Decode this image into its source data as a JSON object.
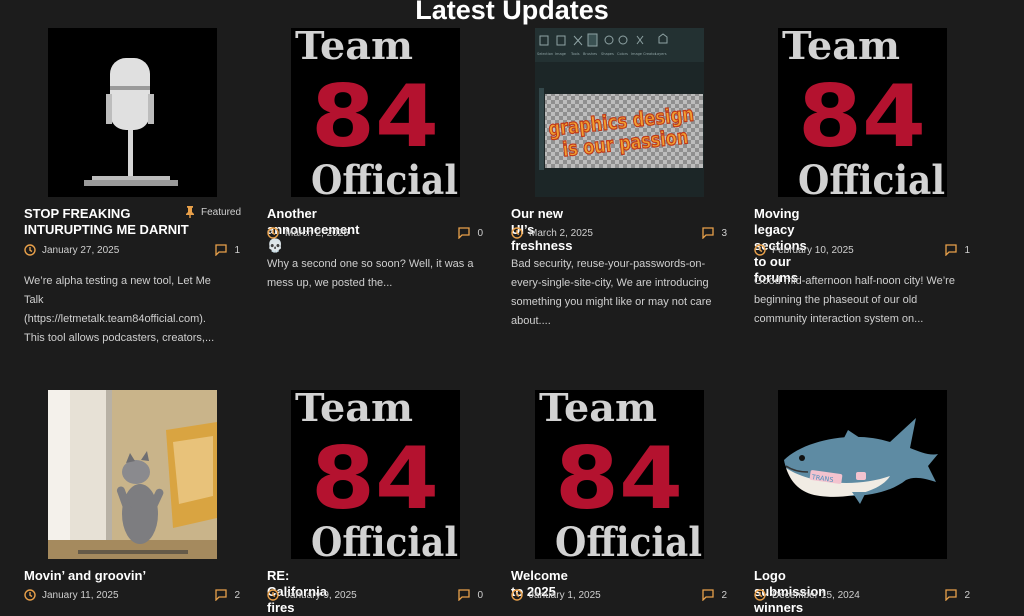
{
  "section_title": "Latest Updates",
  "accent_color": "#e8a04a",
  "brand": {
    "team84_line1": "Team",
    "team84_line2": "84",
    "team84_line3": "Official",
    "team84_red": "#b4122f",
    "team84_grey": "#d2d2d2"
  },
  "posts": [
    {
      "title_line1": "STOP FREAKING",
      "title_line2": "INTURUPTING ME DARNIT",
      "featured_label": "Featured",
      "date": "January 27, 2025",
      "comments": "1",
      "excerpt_lines": [
        "We’re alpha testing a new tool, Let Me",
        "Talk",
        "(https://letmetalk.team84official.com).",
        "This tool allows podcasters, creators,..."
      ],
      "image": "microphone pixel art"
    },
    {
      "title_line1": "Another announcement 💀",
      "date": "March 2, 2025",
      "comments": "0",
      "excerpt_lines": [
        "Why a second one so soon? Well, it was a",
        "mess up, we posted the..."
      ],
      "image": "team84-logo"
    },
    {
      "title_line1": "Our new UI’s freshness",
      "date": "March 2, 2025",
      "comments": "3",
      "excerpt_lines": [
        "Bad security, reuse-your-passwords-on-",
        "every-single-site-city, We are introducing",
        "something you might like or may not care",
        "about...."
      ],
      "image": "graphics editor screenshot",
      "image_text_line1": "graphics design",
      "image_text_line2": "is our passion",
      "toolbar_labels": [
        "Selection",
        "Image",
        "Tools",
        "Brushes",
        "Shapes",
        "Colors",
        "Image Creator",
        "Layers"
      ]
    },
    {
      "title_line1": "Moving legacy sections to our",
      "title_line2": "forums",
      "date": "February 10, 2025",
      "comments": "1",
      "excerpt_lines": [
        "Good mid-afternoon half-noon city! We’re",
        "beginning the phaseout of our old",
        "community interaction system on..."
      ],
      "image": "team84-logo"
    },
    {
      "title_line1": "Movin’ and groovin’",
      "date": "January 11, 2025",
      "comments": "2",
      "image": "dancing cat photo"
    },
    {
      "title_line1": "RE: California fires",
      "date": "January 9, 2025",
      "comments": "0",
      "image": "team84-logo"
    },
    {
      "title_line1": "Welcome to 2025",
      "date": "January 1, 2025",
      "comments": "2",
      "image": "team84-logo"
    },
    {
      "title_line1": "Logo submission winners",
      "date": "December 15, 2024",
      "comments": "2",
      "image": "shark plush",
      "image_tag": "TRANS"
    }
  ],
  "icons": {
    "pin": "pin-icon",
    "clock": "clock-icon",
    "comment": "comment-icon"
  }
}
